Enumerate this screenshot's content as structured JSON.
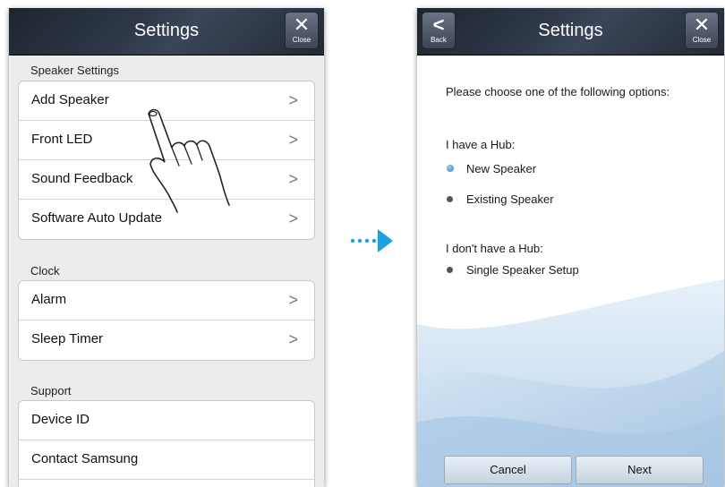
{
  "left_screen": {
    "title": "Settings",
    "close_label": "Close",
    "sections": [
      {
        "label": "Speaker Settings",
        "items": [
          {
            "label": "Add Speaker",
            "chevron": true
          },
          {
            "label": "Front LED",
            "chevron": true
          },
          {
            "label": "Sound Feedback",
            "chevron": true
          },
          {
            "label": "Software Auto Update",
            "chevron": true
          }
        ]
      },
      {
        "label": "Clock",
        "items": [
          {
            "label": "Alarm",
            "chevron": true
          },
          {
            "label": "Sleep Timer",
            "chevron": true
          }
        ]
      },
      {
        "label": "Support",
        "items": [
          {
            "label": "Device ID",
            "chevron": false
          },
          {
            "label": "Contact Samsung",
            "chevron": false
          }
        ]
      }
    ]
  },
  "right_screen": {
    "title": "Settings",
    "back_label": "Back",
    "close_label": "Close",
    "prompt": "Please choose one of the following options:",
    "hub_heading": "I have a Hub:",
    "hub_options": [
      {
        "label": "New Speaker",
        "selected": true
      },
      {
        "label": "Existing Speaker",
        "selected": false
      }
    ],
    "no_hub_heading": "I don't have a Hub:",
    "no_hub_options": [
      {
        "label": "Single Speaker Setup",
        "selected": false
      }
    ],
    "cancel_label": "Cancel",
    "next_label": "Next"
  },
  "colors": {
    "arrow": "#1aa3e0",
    "selected_radio": "#1d7bd8",
    "titlebar": "#2e3848"
  }
}
